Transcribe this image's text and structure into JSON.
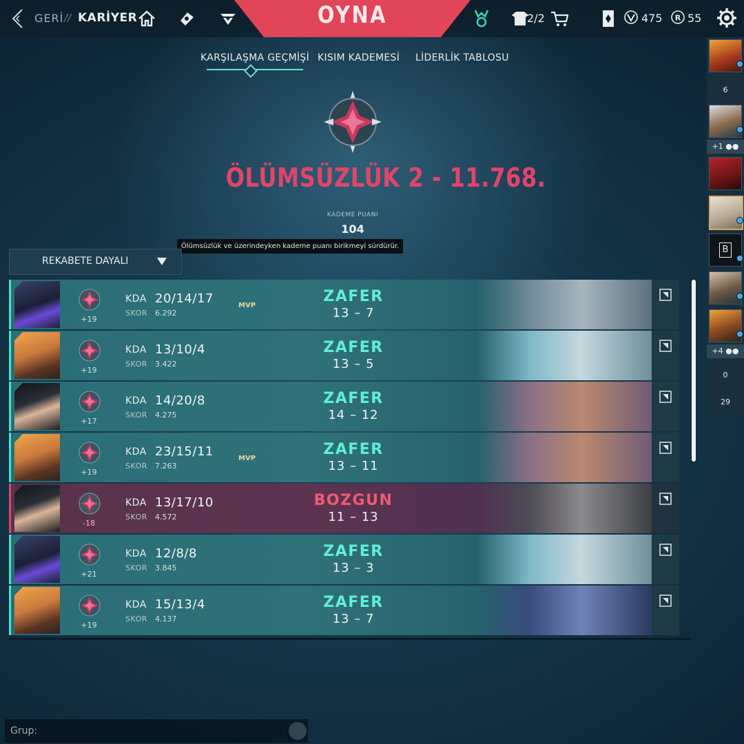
{
  "topbar": {
    "back_label": "GERİ",
    "separator": "//",
    "title": "KARİYER",
    "play_label": "OYNA",
    "collections_count": "2/2",
    "vp_amount": "475",
    "radianite_amount": "55",
    "icons": [
      "back-arrow-icon",
      "home-icon",
      "agents-icon",
      "contracts-icon",
      "battlepass-icon",
      "collections-icon",
      "store-cart-icon",
      "kingdom-credits-icon",
      "vp-icon",
      "radianite-icon",
      "settings-gear-icon"
    ]
  },
  "tabs": [
    {
      "label": "KARŞILAŞMA GEÇMİŞİ",
      "active": true
    },
    {
      "label": "KISIM KADEMESİ",
      "active": false
    },
    {
      "label": "LİDERLİK TABLOSU",
      "active": false
    }
  ],
  "rank": {
    "title": "ÖLÜMSÜZLÜK 2 - 11.768.",
    "rr_label": "KADEME PUANI",
    "rr_value": "104",
    "tooltip": "Ölümsüzlük ve üzerindeyken kademe puanı birikmeyi sürdürür."
  },
  "filter": {
    "label": "REKABETE DAYALI"
  },
  "labels": {
    "kda": "KDA",
    "score": "SKOR"
  },
  "matches": [
    {
      "result": "ZAFER",
      "outcome": "win",
      "score_line": "13 – 7",
      "kda": "20/14/17",
      "score": "6.292",
      "rr_change": "+19",
      "mvp": "MVP",
      "agent": "agent-robot"
    },
    {
      "result": "ZAFER",
      "outcome": "win",
      "score_line": "13 – 5",
      "kda": "13/10/4",
      "score": "3.422",
      "rr_change": "+19",
      "mvp": "",
      "agent": "agent-orange"
    },
    {
      "result": "ZAFER",
      "outcome": "win",
      "score_line": "14 – 12",
      "kda": "14/20/8",
      "score": "4.275",
      "rr_change": "+17",
      "mvp": "",
      "agent": "agent-dark"
    },
    {
      "result": "ZAFER",
      "outcome": "win",
      "score_line": "13 – 11",
      "kda": "23/15/11",
      "score": "7.263",
      "rr_change": "+19",
      "mvp": "MVP",
      "agent": "agent-orange"
    },
    {
      "result": "BOZGUN",
      "outcome": "loss",
      "score_line": "11 – 13",
      "kda": "13/17/10",
      "score": "4.572",
      "rr_change": "-18",
      "mvp": "",
      "agent": "agent-dark"
    },
    {
      "result": "ZAFER",
      "outcome": "win",
      "score_line": "13 – 3",
      "kda": "12/8/8",
      "score": "3.845",
      "rr_change": "+21",
      "mvp": "",
      "agent": "agent-robot"
    },
    {
      "result": "ZAFER",
      "outcome": "win",
      "score_line": "13 – 7",
      "kda": "15/13/4",
      "score": "4.137",
      "rr_change": "+19",
      "mvp": "",
      "agent": "agent-orange"
    }
  ],
  "side_panel": {
    "count_1": "6",
    "party_1": "+1",
    "party_2": "+4",
    "count_2": "0",
    "count_3": "29"
  },
  "chat": {
    "placeholder": "Grup:"
  },
  "colors": {
    "win": "#62eed6",
    "loss": "#f05a72",
    "rank": "#e0456a",
    "play": "#e0455a"
  }
}
